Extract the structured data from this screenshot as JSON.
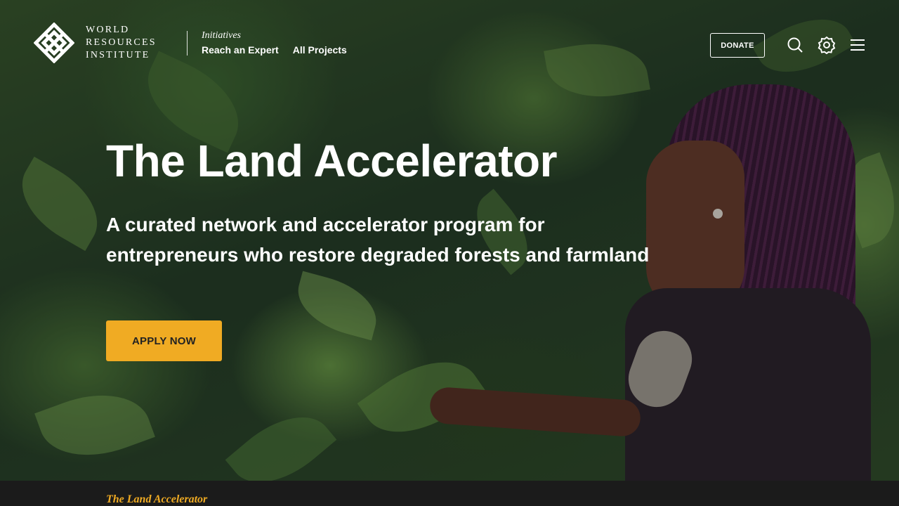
{
  "header": {
    "logo_lines": [
      "WORLD",
      "RESOURCES",
      "INSTITUTE"
    ],
    "initiatives_label": "Initiatives",
    "nav": [
      {
        "label": "Reach an Expert"
      },
      {
        "label": "All Projects"
      }
    ],
    "donate_label": "DONATE",
    "icons": [
      "search-icon",
      "settings-icon",
      "menu-icon"
    ]
  },
  "hero": {
    "title": "The Land Accelerator",
    "subtitle": "A curated network and accelerator program for entrepreneurs who restore degraded forests and farmland",
    "cta_label": "APPLY NOW"
  },
  "bottom_bar": {
    "title": "The Land Accelerator"
  },
  "colors": {
    "accent": "#f0ab23",
    "text": "#ffffff",
    "bar_background": "#1b1b1b"
  }
}
